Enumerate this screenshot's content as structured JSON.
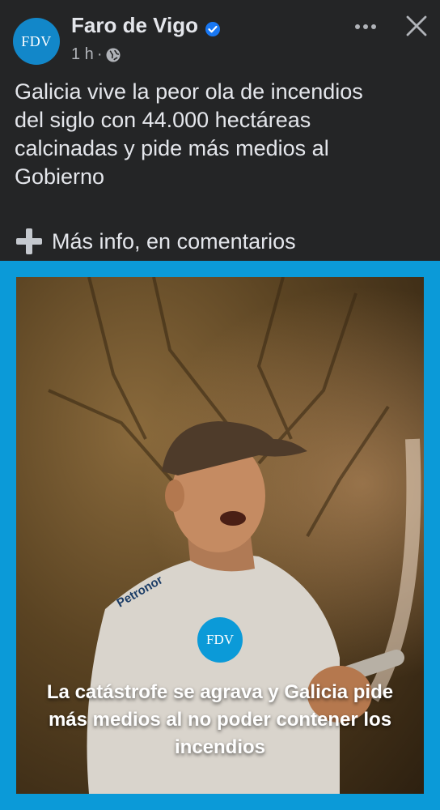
{
  "post": {
    "page_name": "Faro de Vigo",
    "avatar_text": "FDV",
    "time": "1 h",
    "separator": "·",
    "body_lines": [
      "Galicia vive la peor ola de incendios",
      "del siglo con 44.000 hectáreas",
      "calcinadas y pide más medios al",
      "Gobierno"
    ],
    "more_info": "Más info, en comentarios"
  },
  "media": {
    "logo_text": "FDV",
    "caption": "La catástrofe se agrava y Galicia pide más medios al no poder contener los incendios",
    "shirt_text": "Petronor"
  },
  "icons": {
    "verified": "verified-badge-icon",
    "audience": "globe-icon",
    "more": "more-horizontal-icon",
    "close": "close-icon",
    "plus": "plus-icon"
  },
  "colors": {
    "background": "#242526",
    "text": "#e4e6eb",
    "secondary_text": "#b0b3b8",
    "brand_blue": "#0b9ad8",
    "verified_blue": "#1877f2"
  }
}
